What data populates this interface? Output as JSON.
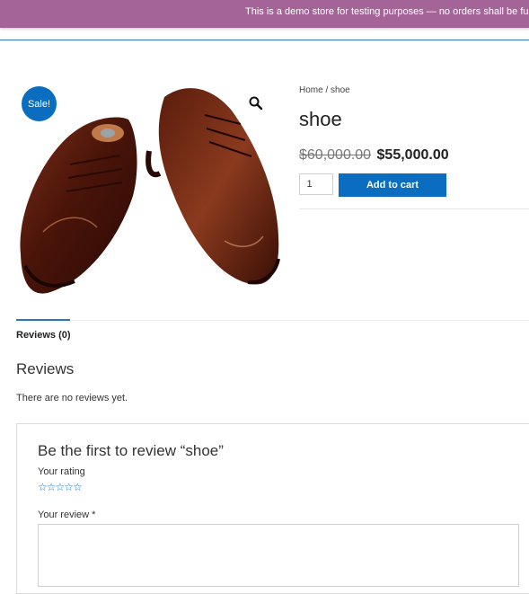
{
  "banner": {
    "text": "This is a demo store for testing purposes — no orders shall be fu"
  },
  "product": {
    "sale_badge": "Sale!",
    "breadcrumb": {
      "home": "Home",
      "separator": " / ",
      "current": "shoe"
    },
    "title": "shoe",
    "price_old": "$60,000.00",
    "price_new": "$55,000.00",
    "quantity": "1",
    "add_to_cart_label": "Add to cart",
    "image_icon": "zoom-icon"
  },
  "tabs": [
    {
      "label": "Reviews (0)",
      "active": true
    }
  ],
  "reviews": {
    "heading": "Reviews",
    "empty_text": "There are no reviews yet.",
    "form_title": "Be the first to review “shoe”",
    "rating_label": "Your rating",
    "stars": "☆☆☆☆☆",
    "review_label": "Your review *"
  },
  "colors": {
    "banner": "#a46497",
    "accent": "#0a6dbf"
  }
}
